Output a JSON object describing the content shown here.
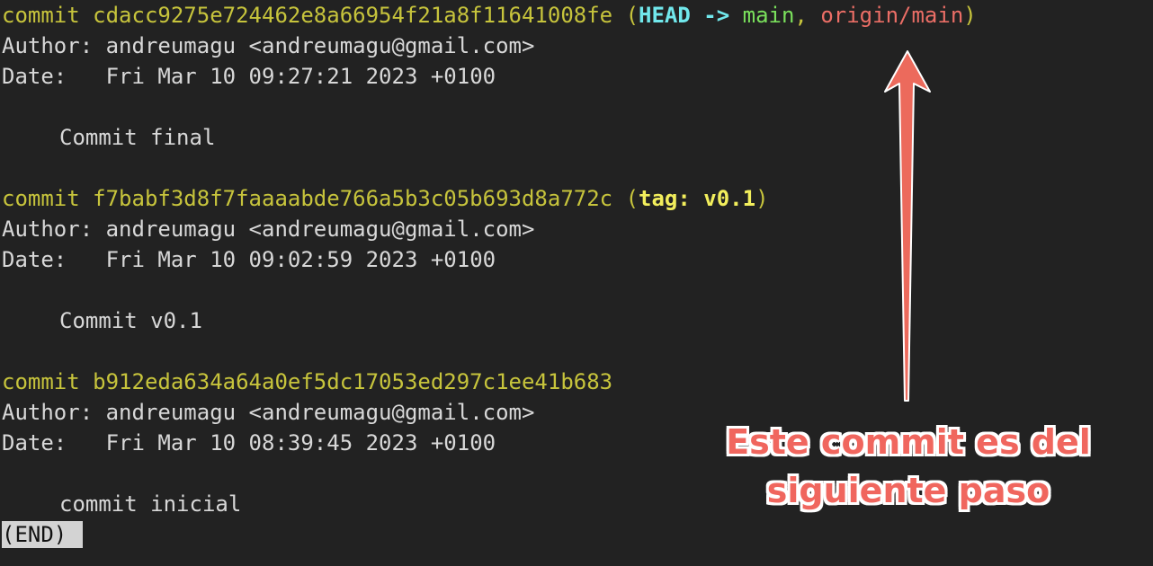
{
  "log": {
    "commits": [
      {
        "commit_word": "commit",
        "hash": "cdacc9275e724462e8a66954f21a8f11641008fe",
        "refs": {
          "open": "(",
          "head": "HEAD",
          "arrow": " -> ",
          "branch": "main",
          "sep": ", ",
          "remote": "origin/main",
          "close": ")"
        },
        "author_label": "Author:",
        "author": "andreumagu <andreumagu@gmail.com>",
        "date_label": "Date:",
        "date": "Fri Mar 10 09:27:21 2023 +0100",
        "message": "Commit final"
      },
      {
        "commit_word": "commit",
        "hash": "f7babf3d8f7faaaabde766a5b3c05b693d8a772c",
        "refs": {
          "open": "(",
          "tag": "tag: v0.1",
          "close": ")"
        },
        "author_label": "Author:",
        "author": "andreumagu <andreumagu@gmail.com>",
        "date_label": "Date:",
        "date": "Fri Mar 10 09:02:59 2023 +0100",
        "message": "Commit v0.1"
      },
      {
        "commit_word": "commit",
        "hash": "b912eda634a64a0ef5dc17053ed297c1ee41b683",
        "author_label": "Author:",
        "author": "andreumagu <andreumagu@gmail.com>",
        "date_label": "Date:",
        "date": "Fri Mar 10 08:39:45 2023 +0100",
        "message": "commit inicial"
      }
    ],
    "end_prompt": "(END)"
  },
  "annotation": {
    "line1": "Este commit es del",
    "line2": "siguiente paso",
    "color": "#f0665e",
    "icon": "up-arrow-icon"
  },
  "colors": {
    "background": "#222222",
    "text": "#d8d8d8",
    "hash": "#c7c43c",
    "head": "#71e8ec",
    "branch": "#7ae05c",
    "remote": "#eb6e66",
    "tag": "#f2ee5c"
  }
}
